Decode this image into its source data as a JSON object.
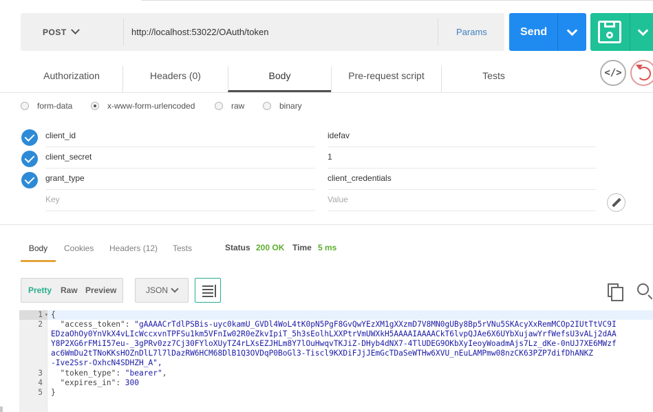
{
  "request": {
    "method": "POST",
    "url": "http://localhost:53022/OAuth/token",
    "params_label": "Params",
    "send_label": "Send"
  },
  "request_tabs": [
    {
      "label": "Authorization"
    },
    {
      "label": "Headers (0)"
    },
    {
      "label": "Body",
      "active": true
    },
    {
      "label": "Pre-request script"
    },
    {
      "label": "Tests"
    }
  ],
  "body_types": [
    {
      "label": "form-data",
      "selected": false
    },
    {
      "label": "x-www-form-urlencoded",
      "selected": true
    },
    {
      "label": "raw",
      "selected": false
    },
    {
      "label": "binary",
      "selected": false
    }
  ],
  "params": [
    {
      "key": "client_id",
      "value": "idefav",
      "enabled": true
    },
    {
      "key": "client_secret",
      "value": "1",
      "enabled": true
    },
    {
      "key": "grant_type",
      "value": "client_credentials",
      "enabled": true
    }
  ],
  "new_param": {
    "key_placeholder": "Key",
    "value_placeholder": "Value"
  },
  "response": {
    "tabs": [
      {
        "label": "Body",
        "active": true
      },
      {
        "label": "Cookies"
      },
      {
        "label": "Headers (12)"
      },
      {
        "label": "Tests"
      }
    ],
    "status_label": "Status",
    "status_value": "200 OK",
    "time_label": "Time",
    "time_value": "5 ms",
    "views": [
      "Pretty",
      "Raw",
      "Preview"
    ],
    "active_view": "Pretty",
    "format": "JSON"
  },
  "code": {
    "line_numbers": [
      "1",
      "2",
      "3",
      "4",
      "5"
    ],
    "open_brace": "{",
    "close_brace": "}",
    "access_token_key": "\"access_token\"",
    "access_token_lines": [
      "\"gAAAACrTdlPSBis-uyc0kamU_GVDl4WoL4tK0pN5PgF8GvQwYEzXM1gXXzmD7V8MN0gUBy8Bp5rVNu5SKAcyXxRemMCOp2IUtTtVC9I",
      "EDzaOhOy0YnVkX4vLIcWccxvnTPFSu1km5VFnIw02R0eZkvIpiT_5h3sEolhLXXPtrVmUWXkH5AAAAIAAAACkT6lvpQJAe6X6UYbXujawYrfWefsU3vALj2dAA",
      "Y8P2XG6rFMiI57eu-_3gPRv0zz7Cj30FYloXUyTZ4rLXsEZJHLm8Y7lOuHwqvTKJiZ-DHyb4dNX7-4TlUDEG9OKbXyIeoyWoadmAjs7Lz_dKe-0nUJ7XE6MWzf",
      "ac6WmDu2tTNoKKsHOZnDlL7l7lDazRW6HCM68DlB1Q3OVDqP0BoGl3-Tiscl9KXDiFJjJEmGcTDaSeWTHw6XVU_nEuLAMPmw08nzCK63PZP7difDhANKZ",
      "-Ive2Ssr-OxhcN4SDHZH_A\","
    ],
    "token_type_key": "\"token_type\"",
    "token_type_value": "\"bearer\"",
    "expires_in_key": "\"expires_in\"",
    "expires_in_value": "300"
  }
}
